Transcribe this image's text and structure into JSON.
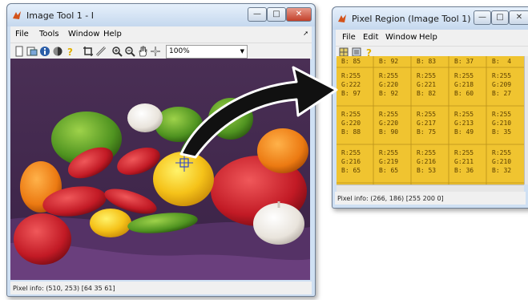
{
  "image_tool": {
    "title": "Image Tool 1 - I",
    "menu": [
      "File",
      "Tools",
      "Window",
      "Help"
    ],
    "zoom": "100%",
    "status": "Pixel info: (510, 253)  [64 35 61]"
  },
  "pixel_region": {
    "title": "Pixel Region (Image Tool 1)",
    "menu": [
      "File",
      "Edit",
      "Window",
      "Help"
    ],
    "status": "Pixel info: (266, 186)  [255 200 0]",
    "top_row": [
      "B: 85",
      "B: 92",
      "B: 83",
      "B: 37",
      "B:  4"
    ],
    "rows": [
      [
        [
          "R:255",
          "G:222",
          "B: 97"
        ],
        [
          "R:255",
          "G:220",
          "B: 92"
        ],
        [
          "R:255",
          "G:221",
          "B: 82"
        ],
        [
          "R:255",
          "G:218",
          "B: 60"
        ],
        [
          "R:255",
          "G:209",
          "B: 27"
        ]
      ],
      [
        [
          "R:255",
          "G:220",
          "B: 88"
        ],
        [
          "R:255",
          "G:220",
          "B: 90"
        ],
        [
          "R:255",
          "G:217",
          "B: 75"
        ],
        [
          "R:255",
          "G:213",
          "B: 49"
        ],
        [
          "R:255",
          "G:210",
          "B: 35"
        ]
      ],
      [
        [
          "R:255",
          "G:216",
          "B: 65"
        ],
        [
          "R:255",
          "G:219",
          "B: 65"
        ],
        [
          "R:255",
          "G:216",
          "B: 53"
        ],
        [
          "R:255",
          "G:211",
          "B: 36"
        ],
        [
          "R:255",
          "G:210",
          "B: 32"
        ]
      ]
    ]
  },
  "colors": {
    "cell_bg": "#f0c430",
    "cell_text": "#5a3e00",
    "chrome": "#cfe0f3",
    "close_button": "#c2402a"
  }
}
